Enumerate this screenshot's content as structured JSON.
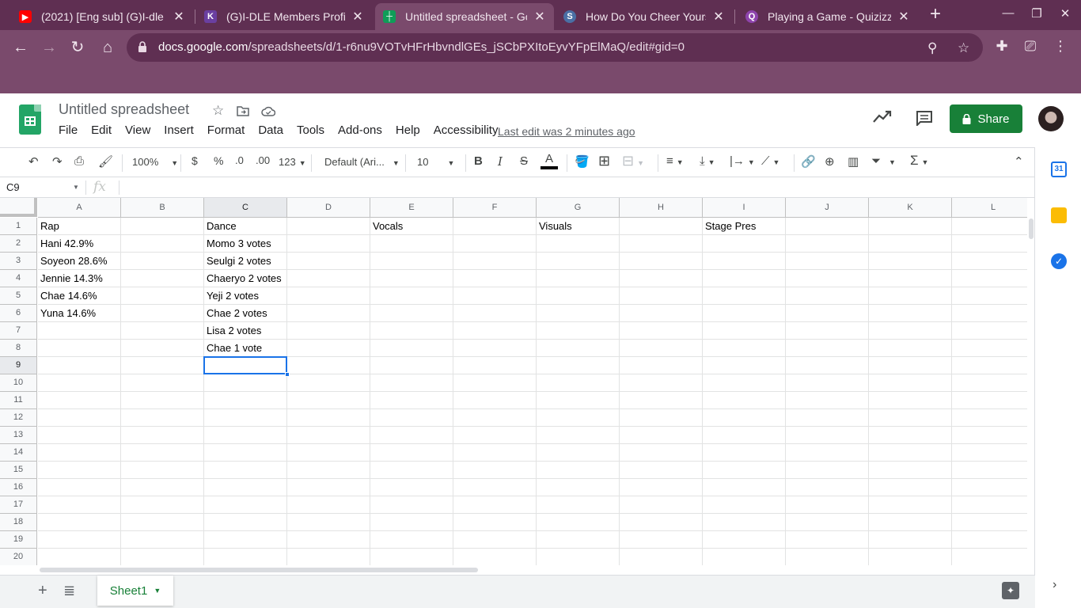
{
  "browser": {
    "tabs": [
      {
        "title": "(2021) [Eng sub] (G)I-dle",
        "icon": "youtube-icon",
        "color": "#ff0000"
      },
      {
        "title": "(G)I-DLE Members Profile",
        "icon": "kprofiles-icon",
        "color": "#6a3fa0"
      },
      {
        "title": "Untitled spreadsheet - Go",
        "icon": "sheets-icon",
        "color": "#0f9d58"
      },
      {
        "title": "How Do You Cheer Yours",
        "icon": "site-icon",
        "color": "#4a6fa5"
      },
      {
        "title": "Playing a Game - Quizizz",
        "icon": "quizizz-icon",
        "color": "#8e44ad"
      }
    ],
    "url_host": "docs.google.com",
    "url_path": "/spreadsheets/d/1-r6nu9VOTvHFrHbvndlGEs_jSCbPXItoEyvYFpElMaQ/edit#gid=0"
  },
  "header": {
    "title": "Untitled spreadsheet",
    "menu": [
      "File",
      "Edit",
      "View",
      "Insert",
      "Format",
      "Data",
      "Tools",
      "Add-ons",
      "Help",
      "Accessibility"
    ],
    "last_edit": "Last edit was 2 minutes ago",
    "share_label": "Share"
  },
  "toolbar": {
    "zoom": "100%",
    "currency": "$",
    "percent": "%",
    "dec_decrease": ".0",
    "dec_increase": ".00",
    "more_formats": "123",
    "font": "Default (Ari...",
    "font_size": "10",
    "bold": "B",
    "italic": "I",
    "strike": "S",
    "text_color": "A"
  },
  "formula_bar": {
    "name_box": "C9",
    "fx": "fx",
    "value": ""
  },
  "grid": {
    "columns": [
      "A",
      "B",
      "C",
      "D",
      "E",
      "F",
      "G",
      "H",
      "I",
      "J",
      "K",
      "L"
    ],
    "rows": [
      "1",
      "2",
      "3",
      "4",
      "5",
      "6",
      "7",
      "8",
      "9",
      "10",
      "11",
      "12",
      "13",
      "14",
      "15",
      "16",
      "17",
      "18",
      "19",
      "20"
    ],
    "selected_cell": "C9",
    "cells": {
      "A1": "Rap",
      "C1": "Dance",
      "E1": "Vocals",
      "G1": "Visuals",
      "I1": "Stage Pres",
      "A2": "Hani 42.9%",
      "C2": "Momo 3 votes",
      "A3": "Soyeon 28.6%",
      "C3": "Seulgi 2 votes",
      "A4": "Jennie 14.3%",
      "C4": "Chaeryo 2 votes",
      "A5": "Chae 14.6%",
      "C5": "Yeji 2 votes",
      "A6": "Yuna 14.6%",
      "C6": "Chae 2 votes",
      "C7": "Lisa 2 votes",
      "C8": "Chae 1 vote"
    }
  },
  "sheets": {
    "active": "Sheet1"
  },
  "colors": {
    "browser_frame": "#5f2f52",
    "sheets_green": "#188038",
    "selection_blue": "#1a73e8"
  }
}
